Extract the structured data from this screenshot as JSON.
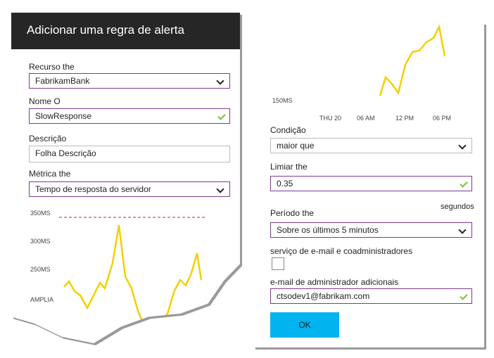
{
  "left": {
    "title": "Adicionar uma regra de alerta",
    "resource_label": "Recurso the",
    "resource_value": "FabrikamBank",
    "name_label": "Nome O",
    "name_value": "SlowResponse",
    "description_label": "Descrição",
    "description_value": "Folha Descrição",
    "metric_label": "Métrica the",
    "metric_value": "Tempo de resposta do servidor",
    "chart_axis": [
      "350MS",
      "300MS",
      "250MS"
    ],
    "chart_footer_label": "AMPLIA"
  },
  "right": {
    "axis_y_label": "150MS",
    "axis_x_labels": [
      "THU 20",
      "06 AM",
      "12 PM",
      "06 PM"
    ],
    "condition_label": "Condição",
    "condition_value": "maior que",
    "threshold_label": "Limiar the",
    "threshold_value": "0.35",
    "seconds_label": "segundos",
    "period_label": "Período the",
    "period_value": "Sobre os últimos 5 minutos",
    "email_admins_label": "serviço de e-mail e coadministradores",
    "extra_email_label": "e-mail de administrador adicionais",
    "extra_email_value": "ctsodev1@fabrikam.com",
    "ok_label": "OK"
  },
  "colors": {
    "header_bg": "#262626",
    "accent_border": "#7c3b8f",
    "chart_line": "#f4d000",
    "threshold_line": "#e05aa8",
    "ok_button": "#00b4f0",
    "check": "#7bbf3a"
  },
  "icons": [
    "chevron-down-icon",
    "check-icon"
  ]
}
